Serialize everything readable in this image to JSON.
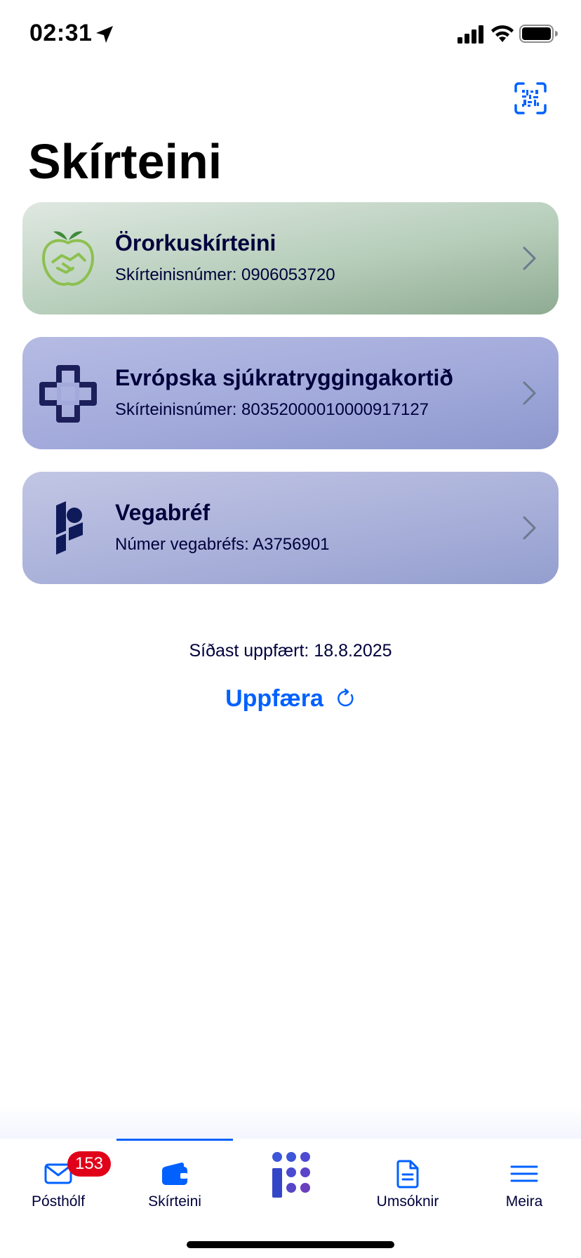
{
  "status_bar": {
    "time": "02:31"
  },
  "header": {
    "title": "Skírteini",
    "scan_icon": "qr-scan-icon"
  },
  "licenses": [
    {
      "title": "Örorkuskírteini",
      "subtitle": "Skírteinisnúmer: 0906053720",
      "icon": "apple-handshake-icon",
      "color": "#8fab92"
    },
    {
      "title": "Evrópska sjúkratryggingakortið",
      "subtitle": "Skírteinisnúmer: 80352000010000917127",
      "icon": "health-cross-icon",
      "color": "#a2aadb"
    },
    {
      "title": "Vegabréf",
      "subtitle": "Númer vegabréfs: A3756901",
      "icon": "island-is-logo-icon",
      "color": "#aab1da"
    }
  ],
  "updated": {
    "text": "Síðast uppfært: 18.8.2025"
  },
  "refresh": {
    "label": "Uppfæra",
    "icon": "refresh-icon"
  },
  "tabbar": {
    "active_index": 1,
    "tabs": [
      {
        "label": "Pósthólf",
        "icon": "mail-icon",
        "badge": "153"
      },
      {
        "label": "Skírteini",
        "icon": "wallet-icon"
      },
      {
        "label": "",
        "icon": "island-is-home-icon"
      },
      {
        "label": "Umsóknir",
        "icon": "document-icon"
      },
      {
        "label": "Meira",
        "icon": "menu-icon"
      }
    ]
  },
  "colors": {
    "accent": "#0061ff",
    "text": "#00003c",
    "badge": "#e10019"
  }
}
